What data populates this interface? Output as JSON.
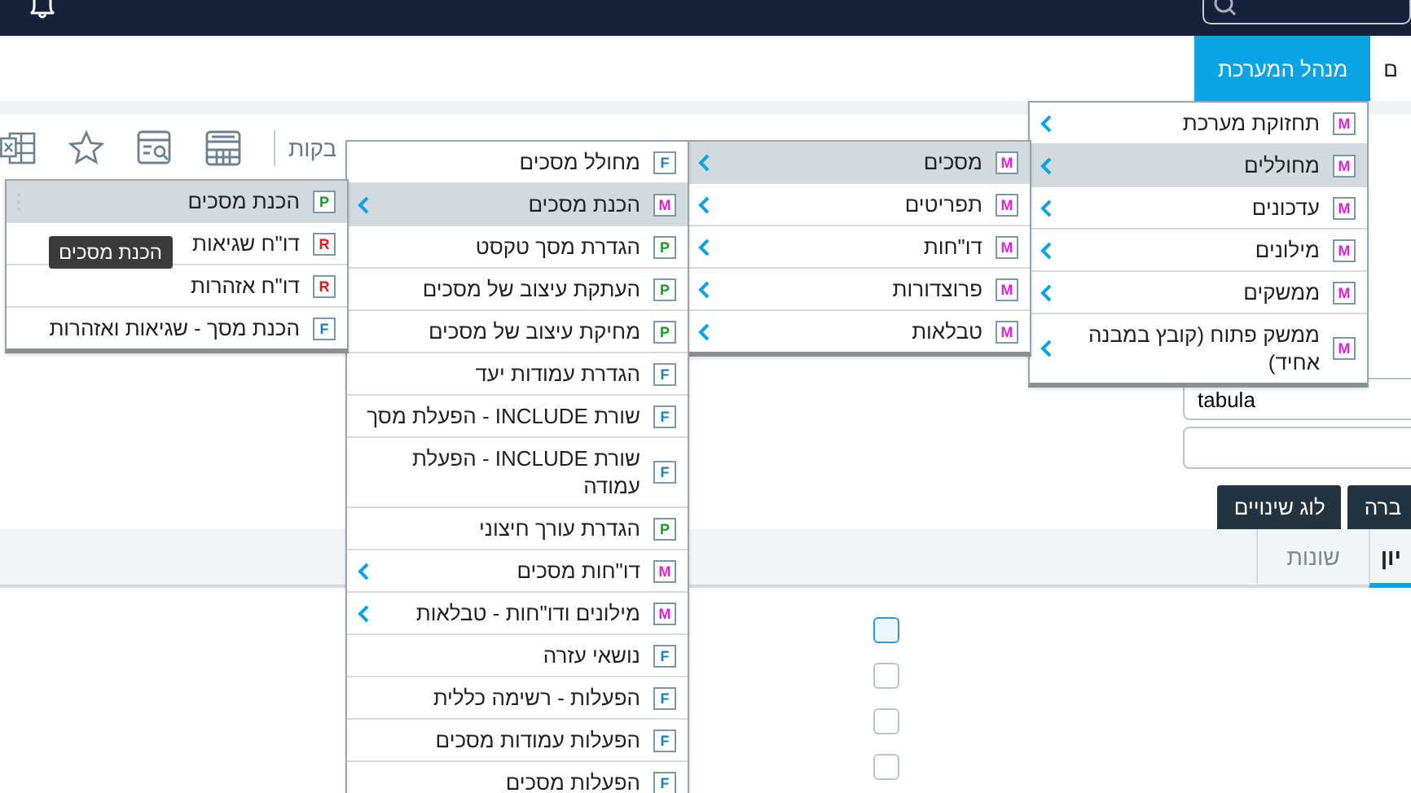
{
  "tabs": [
    {
      "label": "ם",
      "selected": false
    },
    {
      "label": "מנהל המערכת",
      "selected": true
    }
  ],
  "toolbar": {
    "label": "בקות"
  },
  "form": {
    "fields": [
      {
        "value": "tabula"
      }
    ]
  },
  "buttons": [
    "ברה",
    "לוג שינויים"
  ],
  "section_tabs": [
    {
      "label": "יון",
      "selected": true
    },
    {
      "label": "שונות",
      "selected": false
    }
  ],
  "checkboxes": [
    {
      "checked": false,
      "focused": true
    },
    {
      "checked": false,
      "focused": false
    },
    {
      "checked": false,
      "focused": false
    },
    {
      "checked": false,
      "focused": false
    }
  ],
  "menus": [
    {
      "items": [
        {
          "badge": "M",
          "kind": "menu",
          "label": "תחזוקת מערכת",
          "submenu": true,
          "selected": false
        },
        {
          "badge": "M",
          "kind": "menu",
          "label": "מחוללים",
          "submenu": true,
          "selected": true
        },
        {
          "badge": "M",
          "kind": "menu",
          "label": "עדכונים",
          "submenu": true,
          "selected": false
        },
        {
          "badge": "M",
          "kind": "menu",
          "label": "מילונים",
          "submenu": true,
          "selected": false
        },
        {
          "badge": "M",
          "kind": "menu",
          "label": "ממשקים",
          "submenu": true,
          "selected": false
        },
        {
          "badge": "M",
          "kind": "menu",
          "label": "ממשק פתוח (קובץ במבנה אחיד)",
          "submenu": true,
          "selected": false
        }
      ]
    },
    {
      "items": [
        {
          "badge": "M",
          "kind": "menu",
          "label": "מסכים",
          "submenu": true,
          "selected": true
        },
        {
          "badge": "M",
          "kind": "menu",
          "label": "תפריטים",
          "submenu": true,
          "selected": false
        },
        {
          "badge": "M",
          "kind": "menu",
          "label": "דו\"חות",
          "submenu": true,
          "selected": false
        },
        {
          "badge": "M",
          "kind": "menu",
          "label": "פרוצדורות",
          "submenu": true,
          "selected": false
        },
        {
          "badge": "M",
          "kind": "menu",
          "label": "טבלאות",
          "submenu": true,
          "selected": false
        }
      ]
    },
    {
      "items": [
        {
          "badge": "F",
          "kind": "form",
          "label": "מחולל מסכים",
          "submenu": false,
          "selected": false
        },
        {
          "badge": "M",
          "kind": "menu",
          "label": "הכנת מסכים",
          "submenu": true,
          "selected": true
        },
        {
          "badge": "P",
          "kind": "program",
          "label": "הגדרת מסך טקסט",
          "submenu": false,
          "selected": false
        },
        {
          "badge": "P",
          "kind": "program",
          "label": "העתקת עיצוב של מסכים",
          "submenu": false,
          "selected": false
        },
        {
          "badge": "P",
          "kind": "program",
          "label": "מחיקת עיצוב של מסכים",
          "submenu": false,
          "selected": false
        },
        {
          "badge": "F",
          "kind": "form",
          "label": "הגדרת עמודות יעד",
          "submenu": false,
          "selected": false
        },
        {
          "badge": "F",
          "kind": "form",
          "label": "שורת INCLUDE - הפעלת מסך",
          "submenu": false,
          "selected": false
        },
        {
          "badge": "F",
          "kind": "form",
          "label": "שורת INCLUDE - הפעלת עמודה",
          "submenu": false,
          "selected": false
        },
        {
          "badge": "P",
          "kind": "program",
          "label": "הגדרת עורך חיצוני",
          "submenu": false,
          "selected": false
        },
        {
          "badge": "M",
          "kind": "menu",
          "label": "דו\"חות מסכים",
          "submenu": true,
          "selected": false
        },
        {
          "badge": "M",
          "kind": "menu",
          "label": "מילונים ודו\"חות - טבלאות",
          "submenu": true,
          "selected": false
        },
        {
          "badge": "F",
          "kind": "form",
          "label": "נושאי עזרה",
          "submenu": false,
          "selected": false
        },
        {
          "badge": "F",
          "kind": "form",
          "label": "הפעלות - רשימה כללית",
          "submenu": false,
          "selected": false
        },
        {
          "badge": "F",
          "kind": "form",
          "label": "הפעלות עמודות מסכים",
          "submenu": false,
          "selected": false
        },
        {
          "badge": "F",
          "kind": "form",
          "label": "הפעלות מסכים",
          "submenu": false,
          "selected": false
        }
      ]
    },
    {
      "items": [
        {
          "badge": "P",
          "kind": "program",
          "label": "הכנת מסכים",
          "submenu": false,
          "selected": true,
          "handle": true
        },
        {
          "badge": "R",
          "kind": "report",
          "label": "דו\"ח שגיאות",
          "submenu": false,
          "selected": false,
          "handle": false
        },
        {
          "badge": "R",
          "kind": "report",
          "label": "דו\"ח אזהרות",
          "submenu": false,
          "selected": false,
          "handle": false
        },
        {
          "badge": "F",
          "kind": "form",
          "label": "הכנת מסך - שגיאות ואזהרות",
          "submenu": false,
          "selected": false,
          "handle": false
        }
      ]
    }
  ],
  "tooltip": {
    "text": "הכנת מסכים"
  }
}
